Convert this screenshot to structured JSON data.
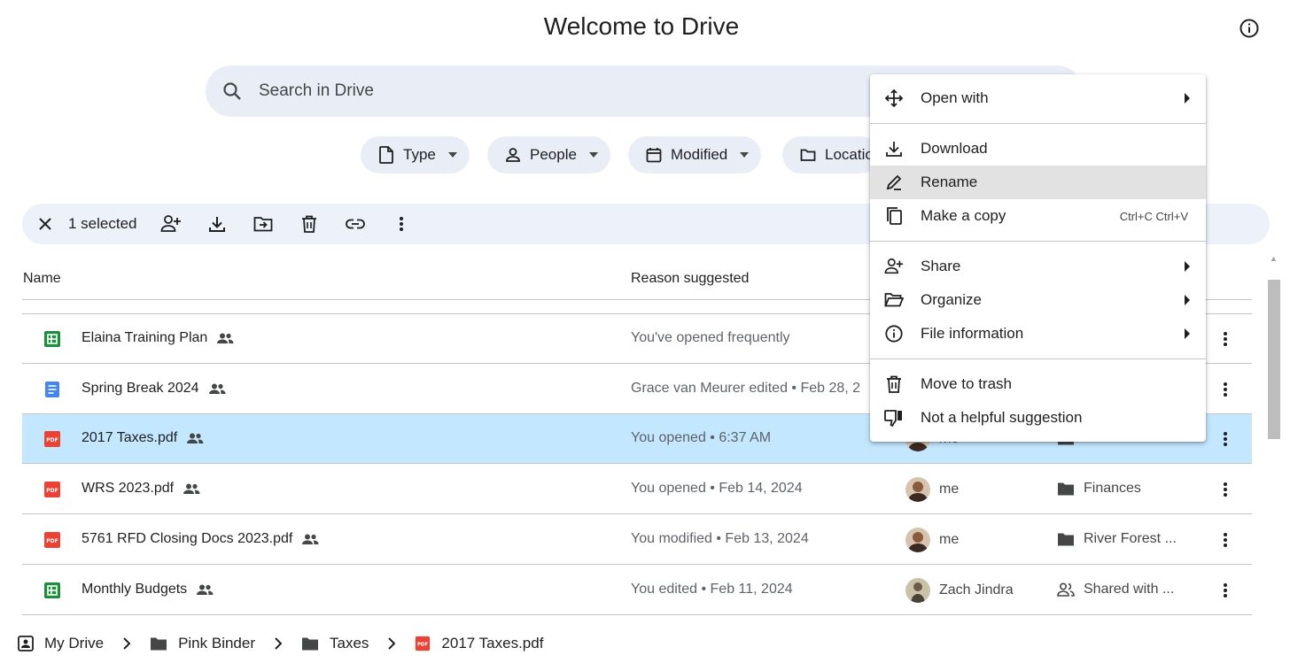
{
  "page": {
    "title": "Welcome to Drive"
  },
  "search": {
    "placeholder": "Search in Drive"
  },
  "filters": [
    {
      "label": "Type"
    },
    {
      "label": "People"
    },
    {
      "label": "Modified"
    },
    {
      "label": "Locatio"
    }
  ],
  "selection": {
    "count_label": "1 selected"
  },
  "columns": {
    "name": "Name",
    "reason": "Reason suggested"
  },
  "files": [
    {
      "name": "Elaina Training Plan",
      "type": "sheet",
      "reason": "You've opened frequently",
      "owner": "",
      "location": ""
    },
    {
      "name": "Spring Break 2024",
      "type": "doc",
      "reason": "Grace van Meurer edited • Feb 28, 2",
      "owner": "",
      "location": ""
    },
    {
      "name": "2017 Taxes.pdf",
      "type": "pdf",
      "reason": "You opened • 6:37 AM",
      "owner": "me",
      "location": "Taxes",
      "selected": true
    },
    {
      "name": "WRS 2023.pdf",
      "type": "pdf",
      "reason": "You opened • Feb 14, 2024",
      "owner": "me",
      "location": "Finances"
    },
    {
      "name": "5761 RFD Closing Docs 2023.pdf",
      "type": "pdf",
      "reason": "You modified • Feb 13, 2024",
      "owner": "me",
      "location": "River Forest ..."
    },
    {
      "name": "Monthly Budgets",
      "type": "sheet",
      "reason": "You edited • Feb 11, 2024",
      "owner": "Zach Jindra",
      "location": "Shared with ..."
    }
  ],
  "breadcrumb": [
    {
      "label": "My Drive"
    },
    {
      "label": "Pink Binder"
    },
    {
      "label": "Taxes"
    },
    {
      "label": "2017 Taxes.pdf"
    }
  ],
  "context_menu": {
    "open_with": "Open with",
    "download": "Download",
    "rename": "Rename",
    "make_copy": "Make a copy",
    "make_copy_shortcut": "Ctrl+C Ctrl+V",
    "share": "Share",
    "organize": "Organize",
    "file_information": "File information",
    "move_to_trash": "Move to trash",
    "not_helpful": "Not a helpful suggestion"
  },
  "colors": {
    "selected_row": "#c2e7ff",
    "search_bg": "#e9eef6",
    "sheet_green": "#1e8e3e",
    "doc_blue": "#4285f4",
    "pdf_red": "#ea4335"
  }
}
